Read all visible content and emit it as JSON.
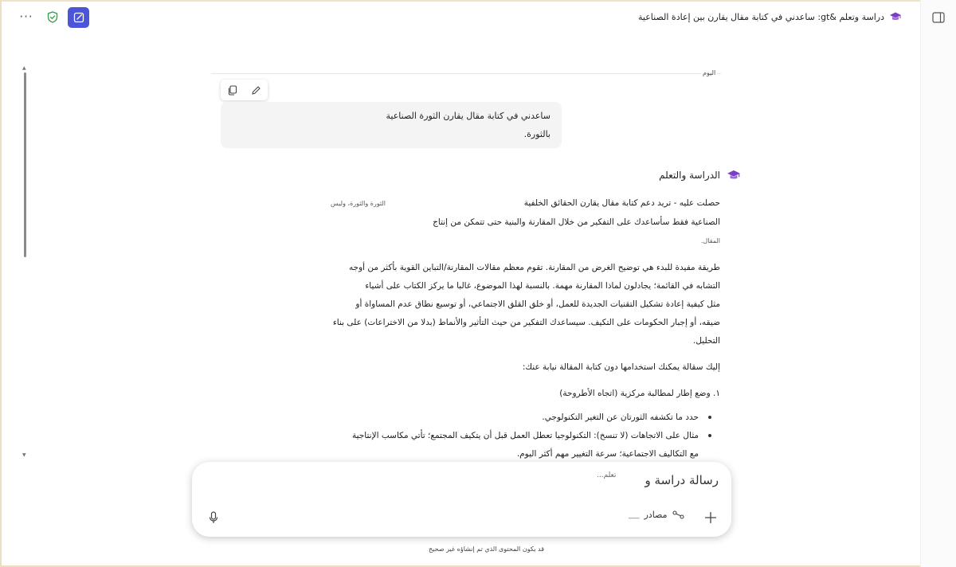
{
  "header": {
    "title": "دراسة وتعلم &gt: ساعدني في كتابة مقال يقارن بين إعادة الصناعية",
    "more_label": "···"
  },
  "conversation": {
    "date_label": "اليوم",
    "user_message": {
      "line1": "ساعدني في كتابة مقال يقارن الثورة الصناعية",
      "line2": "بالثورة."
    },
    "assistant_name": "الدراسة والتعلم",
    "assistant_lines": [
      "حصلت عليه - تريد دعم كتابة مقال يقارن الحقائق الخلفية",
      "الثورة والثورة، وليس",
      "الصناعية فقط سأساعدك على التفكير من خلال المقارنة والبنية حتى تتمكن من إنتاج",
      "المقال.",
      "طريقة مفيدة للبدء هي توضيح الغرض من المقارنة. تقوم معظم مقالات المقارنة/التباين القوية بأكثر من أوجه",
      "التشابه في القائمة؛ يجادلون لماذا المقارنة مهمة. بالنسبة لهذا الموضوع، غالبا ما يركز الكتاب على أشياء",
      "مثل كيفية إعادة تشكيل التقنيات الجديدة للعمل، أو خلق القلق الاجتماعي، أو توسيع نطاق عدم المساواة أو",
      "ضيقه، أو إجبار الحكومات على التكيف. سيساعدك التفكير من حيث التأثير والأنماط (بدلا من الاختراعات) على بناء",
      "التحليل.",
      "إليك سقالة يمكنك استخدامها دون كتابة المقالة نيابة عنك:",
      "١.  وضع إطار لمطالبة مركزية (اتجاه الأطروحة)",
      "حدد ما تكشفه الثورتان عن التغير التكنولوجي.",
      "مثال على الاتجاهات (لا تنسخ): التكنولوجيا تعطل العمل قبل أن يتكيف المجتمع؛ تأتي مكاسب الإنتاجية",
      "مع التكاليف الاجتماعية؛ سرعة التغيير مهم أكثر اليوم."
    ]
  },
  "composer": {
    "placeholder": "رسالة دراسة و",
    "placeholder_tail": "تعلم...",
    "sources_label": "مصادر",
    "sources_dash": "___"
  },
  "disclaimer": "قد يكون المحتوى الذي تم إنشاؤه غير صحيح",
  "colors": {
    "accent": "#4c55d8",
    "shield": "#2f9e44",
    "study_icon": "#7b3fc4"
  },
  "icons": {
    "more": "more-icon",
    "shield": "shield-icon",
    "new_chat": "new-chat-icon",
    "sidebar": "sidebar-toggle-icon",
    "copy": "copy-icon",
    "edit": "edit-icon",
    "study": "graduation-cap-icon",
    "mic": "microphone-icon",
    "plus": "plus-icon",
    "sources": "sources-icon"
  }
}
